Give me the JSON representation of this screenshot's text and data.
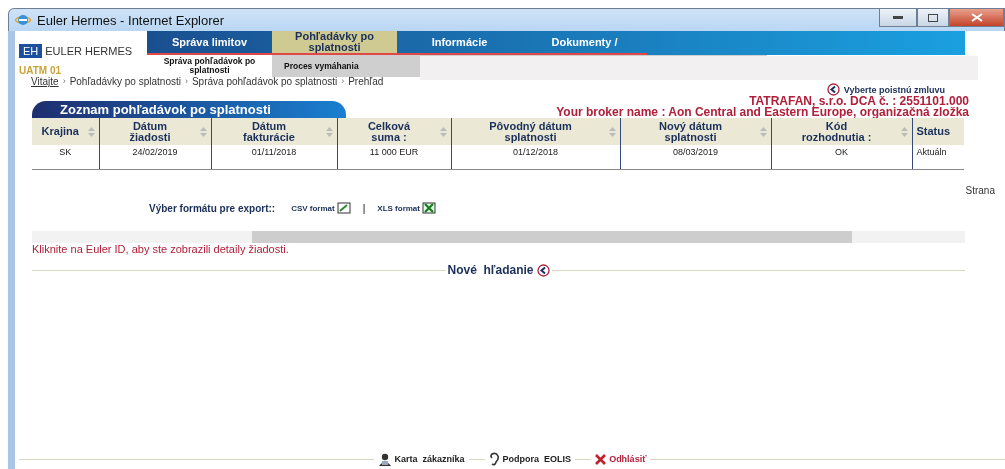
{
  "window": {
    "title": "Euler Hermes - Internet Explorer"
  },
  "logo": {
    "mark": "EH",
    "name": "EULER HERMES"
  },
  "nav": [
    {
      "label": "Správa limitov",
      "selected": false
    },
    {
      "label": "Pohľadávky po splatnosti",
      "selected": true
    },
    {
      "label": "Informácie",
      "selected": false
    },
    {
      "label": "Dokumenty /",
      "selected": false
    }
  ],
  "subnav": [
    {
      "label": "Správa pohľadávok po splatnosti",
      "selected": true
    },
    {
      "label": "Proces vymáhania",
      "selected": false
    }
  ],
  "user_code": "UATM 01",
  "breadcrumb_separator": "›",
  "breadcrumb": [
    {
      "label": "Vitajte",
      "link": true
    },
    {
      "label": "Pohľadávky po splatnosti",
      "link": false
    },
    {
      "label": "Správa pohľadávok po splatnosti",
      "link": false
    },
    {
      "label": "Prehľad",
      "link": false
    }
  ],
  "select_contract": "Vyberte poistnú zmluvu",
  "panel_title": "Zoznam pohľadávok po splatnosti",
  "company": "TATRAFAN, s.r.o. DCA č. : 2551101.000",
  "broker": "Your broker name : Aon Central and Eastern Europe, organizačná zložka",
  "table": {
    "columns": [
      {
        "label": "Krajina",
        "sortable": true
      },
      {
        "label": "Dátum žiadosti",
        "sortable": true
      },
      {
        "label": "Dátum fakturácie",
        "sortable": true
      },
      {
        "label": "Celková suma :",
        "sortable": true
      },
      {
        "label": "Pôvodný dátum splatnosti",
        "sortable": true
      },
      {
        "label": "Nový dátum splatnosti",
        "sortable": true
      },
      {
        "label": "Kód rozhodnutia :",
        "sortable": true
      },
      {
        "label": "Status",
        "sortable": false
      }
    ],
    "rows": [
      [
        "SK",
        "24/02/2019",
        "01/11/2018",
        "11 000 EUR",
        "01/12/2018",
        "08/03/2019",
        "OK",
        "Aktuáln"
      ]
    ]
  },
  "page_label": "Strana",
  "export": {
    "label": "Výber formátu pre export::",
    "separator": "|",
    "options": [
      {
        "label": "CSV format",
        "kind": "csv"
      },
      {
        "label": "XLS format",
        "kind": "xls"
      }
    ]
  },
  "hint": "Kliknite na Euler ID, aby ste zobrazili detaily žiadosti.",
  "new_search": "Nové  hľadanie",
  "footer": [
    {
      "label": "Karta  zákazníka",
      "kind": "customer"
    },
    {
      "label": "Podpora  EOLIS",
      "kind": "support"
    },
    {
      "label": "Odhlásiť",
      "kind": "logout"
    }
  ]
}
